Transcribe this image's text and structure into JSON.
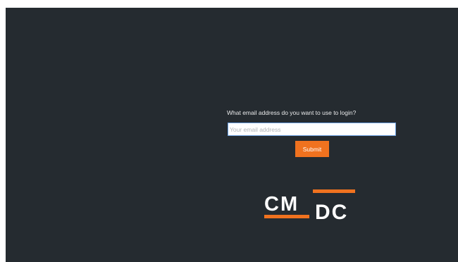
{
  "login": {
    "prompt": "What email address do you want to use to login?",
    "email_placeholder": "Your email address",
    "email_value": "",
    "submit_label": "Submit"
  },
  "logo": {
    "top_text": "CM",
    "bottom_text": "DC",
    "accent_color": "#f0721f"
  },
  "colors": {
    "background": "#252b30",
    "accent": "#f0721f",
    "input_focus_border": "#6a9fe0"
  }
}
